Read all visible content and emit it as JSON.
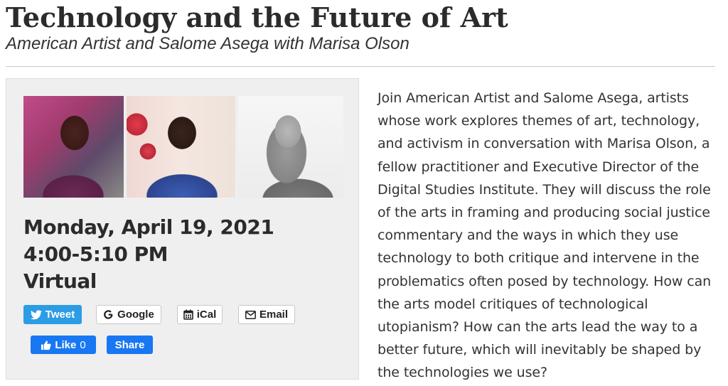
{
  "header": {
    "title": "Technology and the Future of Art",
    "subtitle": "American Artist and Salome Asega with Marisa Olson"
  },
  "event": {
    "date": "Monday, April 19, 2021",
    "time": "4:00-5:10 PM",
    "location": "Virtual"
  },
  "buttons": {
    "tweet": "Tweet",
    "google": "Google",
    "ical": "iCal",
    "email": "Email",
    "like": "Like",
    "like_count": "0",
    "share": "Share"
  },
  "icons": {
    "tweet": "twitter-bird-icon",
    "google": "google-g-icon",
    "ical": "calendar-icon",
    "email": "envelope-icon",
    "like": "thumbs-up-icon"
  },
  "colors": {
    "twitter_blue": "#2c9ce4",
    "facebook_blue": "#1877f2",
    "card_bg": "#efefef"
  },
  "description": "Join American Artist and Salome Asega, artists whose work explores themes of art, technology, and activism in conversation with Marisa Olson, a fellow practitioner and Executive Director of the Digital Studies Institute. They will discuss the role of the arts in framing and producing social justice commentary and the ways in which they use technology to both critique and intervene in the problematics often posed by technology. How can the arts model critiques of technological utopianism? How can the arts lead the way to a better future, which will inevitably be shaped by the technologies we use?"
}
